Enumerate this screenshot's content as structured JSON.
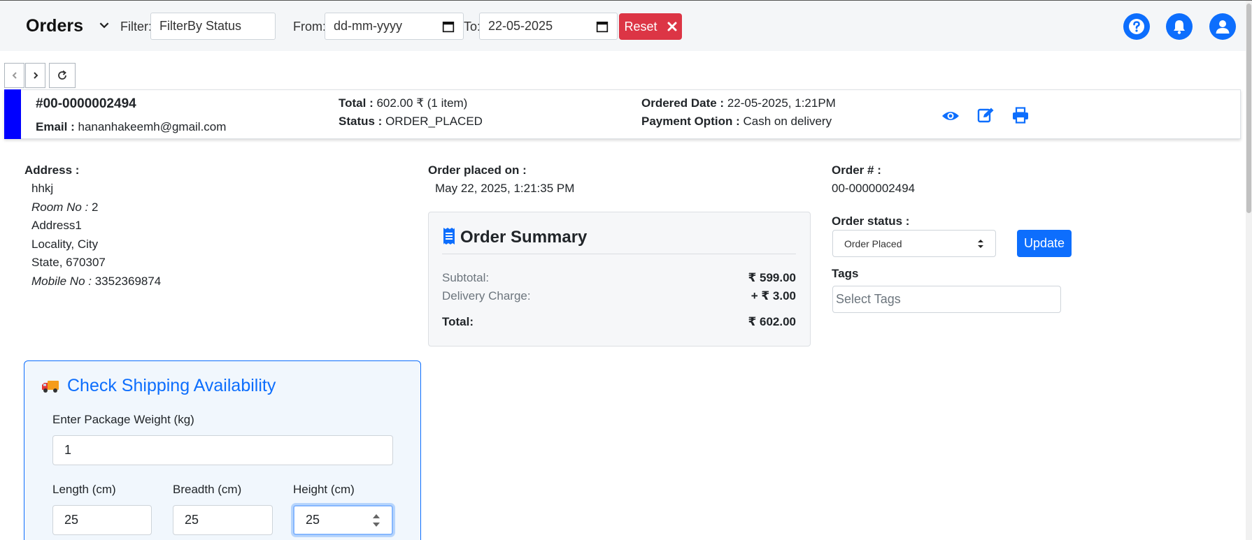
{
  "header": {
    "title": "Orders",
    "filter_label": "Filter:",
    "filter_value": "FilterBy Status",
    "from_label": "From:",
    "from_value": "dd-mm-yyyy",
    "to_label": "To:",
    "to_value": "22-05-2025",
    "reset_label": "Reset"
  },
  "order": {
    "number": "#00-0000002494",
    "email_label": "Email :",
    "email": "hananhakeemh@gmail.com",
    "total_label": "Total :",
    "total": "602.00 ₹ (1 item)",
    "status_label": "Status :",
    "status": "ORDER_PLACED",
    "ordered_date_label": "Ordered Date :",
    "ordered_date": "22-05-2025, 1:21PM",
    "payment_label": "Payment Option :",
    "payment": "Cash on delivery",
    "stripe_color": "#0000ff"
  },
  "address": {
    "heading": "Address :",
    "name": "hhkj",
    "room_label": "Room No :",
    "room": "2",
    "line1": "Address1",
    "line2": "Locality, City",
    "line3": "State, 670307",
    "mobile_label": "Mobile No :",
    "mobile": "3352369874"
  },
  "placed": {
    "heading": "Order placed on :",
    "value": "May 22, 2025, 1:21:35 PM"
  },
  "summary": {
    "title": "Order Summary",
    "subtotal_label": "Subtotal:",
    "subtotal": "₹ 599.00",
    "delivery_label": "Delivery Charge:",
    "delivery": "+ ₹ 3.00",
    "total_label": "Total:",
    "total": "₹ 602.00"
  },
  "order_info": {
    "number_heading": "Order # :",
    "number": "00-0000002494",
    "status_heading": "Order status :",
    "status_selected": "Order Placed",
    "update_label": "Update",
    "tags_heading": "Tags",
    "tags_placeholder": "Select Tags"
  },
  "shipping": {
    "title": "Check Shipping Availability",
    "weight_label": "Enter Package Weight (kg)",
    "weight": "1",
    "length_label": "Length (cm)",
    "length": "25",
    "breadth_label": "Breadth (cm)",
    "breadth": "25",
    "height_label": "Height (cm)",
    "height": "25"
  },
  "colors": {
    "primary": "#0d6efd",
    "danger": "#dc3545"
  }
}
